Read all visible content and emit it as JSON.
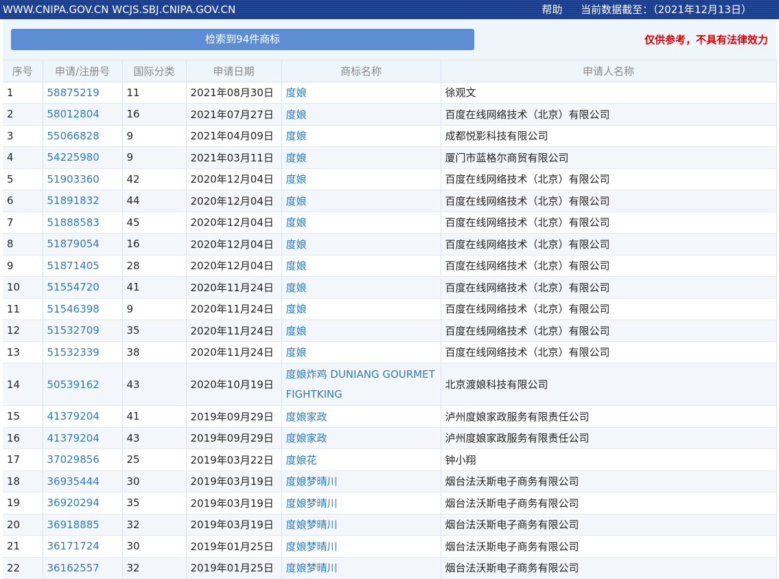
{
  "topbar": {
    "sites": "WWW.CNIPA.GOV.CN WCJS.SBJ.CNIPA.GOV.CN",
    "help": "帮助",
    "data_as_of": "当前数据截至：（2021年12月13日）"
  },
  "result_button": "检索到94件商标",
  "disclaimer": "仅供参考，不具有法律效力",
  "table": {
    "headers": [
      "序号",
      "申请/注册号",
      "国际分类",
      "申请日期",
      "商标名称",
      "申请人名称"
    ],
    "rows": [
      {
        "no": "1",
        "reg": "58875219",
        "cls": "11",
        "date": "2021年08月30日",
        "name": "度娘",
        "applicant": "徐观文"
      },
      {
        "no": "2",
        "reg": "58012804",
        "cls": "16",
        "date": "2021年07月27日",
        "name": "度娘",
        "applicant": "百度在线网络技术（北京）有限公司"
      },
      {
        "no": "3",
        "reg": "55066828",
        "cls": "9",
        "date": "2021年04月09日",
        "name": "度娘",
        "applicant": "成都悦影科技有限公司"
      },
      {
        "no": "4",
        "reg": "54225980",
        "cls": "9",
        "date": "2021年03月11日",
        "name": "度娘",
        "applicant": "厦门市蓝格尔商贸有限公司"
      },
      {
        "no": "5",
        "reg": "51903360",
        "cls": "42",
        "date": "2020年12月04日",
        "name": "度娘",
        "applicant": "百度在线网络技术（北京）有限公司"
      },
      {
        "no": "6",
        "reg": "51891832",
        "cls": "44",
        "date": "2020年12月04日",
        "name": "度娘",
        "applicant": "百度在线网络技术（北京）有限公司"
      },
      {
        "no": "7",
        "reg": "51888583",
        "cls": "45",
        "date": "2020年12月04日",
        "name": "度娘",
        "applicant": "百度在线网络技术（北京）有限公司"
      },
      {
        "no": "8",
        "reg": "51879054",
        "cls": "16",
        "date": "2020年12月04日",
        "name": "度娘",
        "applicant": "百度在线网络技术（北京）有限公司"
      },
      {
        "no": "9",
        "reg": "51871405",
        "cls": "28",
        "date": "2020年12月04日",
        "name": "度娘",
        "applicant": "百度在线网络技术（北京）有限公司"
      },
      {
        "no": "10",
        "reg": "51554720",
        "cls": "41",
        "date": "2020年11月24日",
        "name": "度娘",
        "applicant": "百度在线网络技术（北京）有限公司"
      },
      {
        "no": "11",
        "reg": "51546398",
        "cls": "9",
        "date": "2020年11月24日",
        "name": "度娘",
        "applicant": "百度在线网络技术（北京）有限公司"
      },
      {
        "no": "12",
        "reg": "51532709",
        "cls": "35",
        "date": "2020年11月24日",
        "name": "度娘",
        "applicant": "百度在线网络技术（北京）有限公司"
      },
      {
        "no": "13",
        "reg": "51532339",
        "cls": "38",
        "date": "2020年11月24日",
        "name": "度娘",
        "applicant": "百度在线网络技术（北京）有限公司"
      },
      {
        "no": "14",
        "reg": "50539162",
        "cls": "43",
        "date": "2020年10月19日",
        "name": "度娘炸鸡 DUNIANG GOURMET FIGHTKING",
        "applicant": "北京渡娘科技有限公司"
      },
      {
        "no": "15",
        "reg": "41379204",
        "cls": "41",
        "date": "2019年09月29日",
        "name": "度娘家政",
        "applicant": "泸州度娘家政服务有限责任公司"
      },
      {
        "no": "16",
        "reg": "41379204",
        "cls": "43",
        "date": "2019年09月29日",
        "name": "度娘家政",
        "applicant": "泸州度娘家政服务有限责任公司"
      },
      {
        "no": "17",
        "reg": "37029856",
        "cls": "25",
        "date": "2019年03月22日",
        "name": "度娘花",
        "applicant": "钟小翔"
      },
      {
        "no": "18",
        "reg": "36935444",
        "cls": "30",
        "date": "2019年03月19日",
        "name": "度娘梦晴川",
        "applicant": "烟台法沃斯电子商务有限公司"
      },
      {
        "no": "19",
        "reg": "36920294",
        "cls": "35",
        "date": "2019年03月19日",
        "name": "度娘梦晴川",
        "applicant": "烟台法沃斯电子商务有限公司"
      },
      {
        "no": "20",
        "reg": "36918885",
        "cls": "32",
        "date": "2019年03月19日",
        "name": "度娘梦晴川",
        "applicant": "烟台法沃斯电子商务有限公司"
      },
      {
        "no": "21",
        "reg": "36171724",
        "cls": "30",
        "date": "2019年01月25日",
        "name": "度娘梦晴川",
        "applicant": "烟台法沃斯电子商务有限公司"
      },
      {
        "no": "22",
        "reg": "36162557",
        "cls": "32",
        "date": "2019年01月25日",
        "name": "度娘梦晴川",
        "applicant": "烟台法沃斯电子商务有限公司"
      }
    ]
  }
}
